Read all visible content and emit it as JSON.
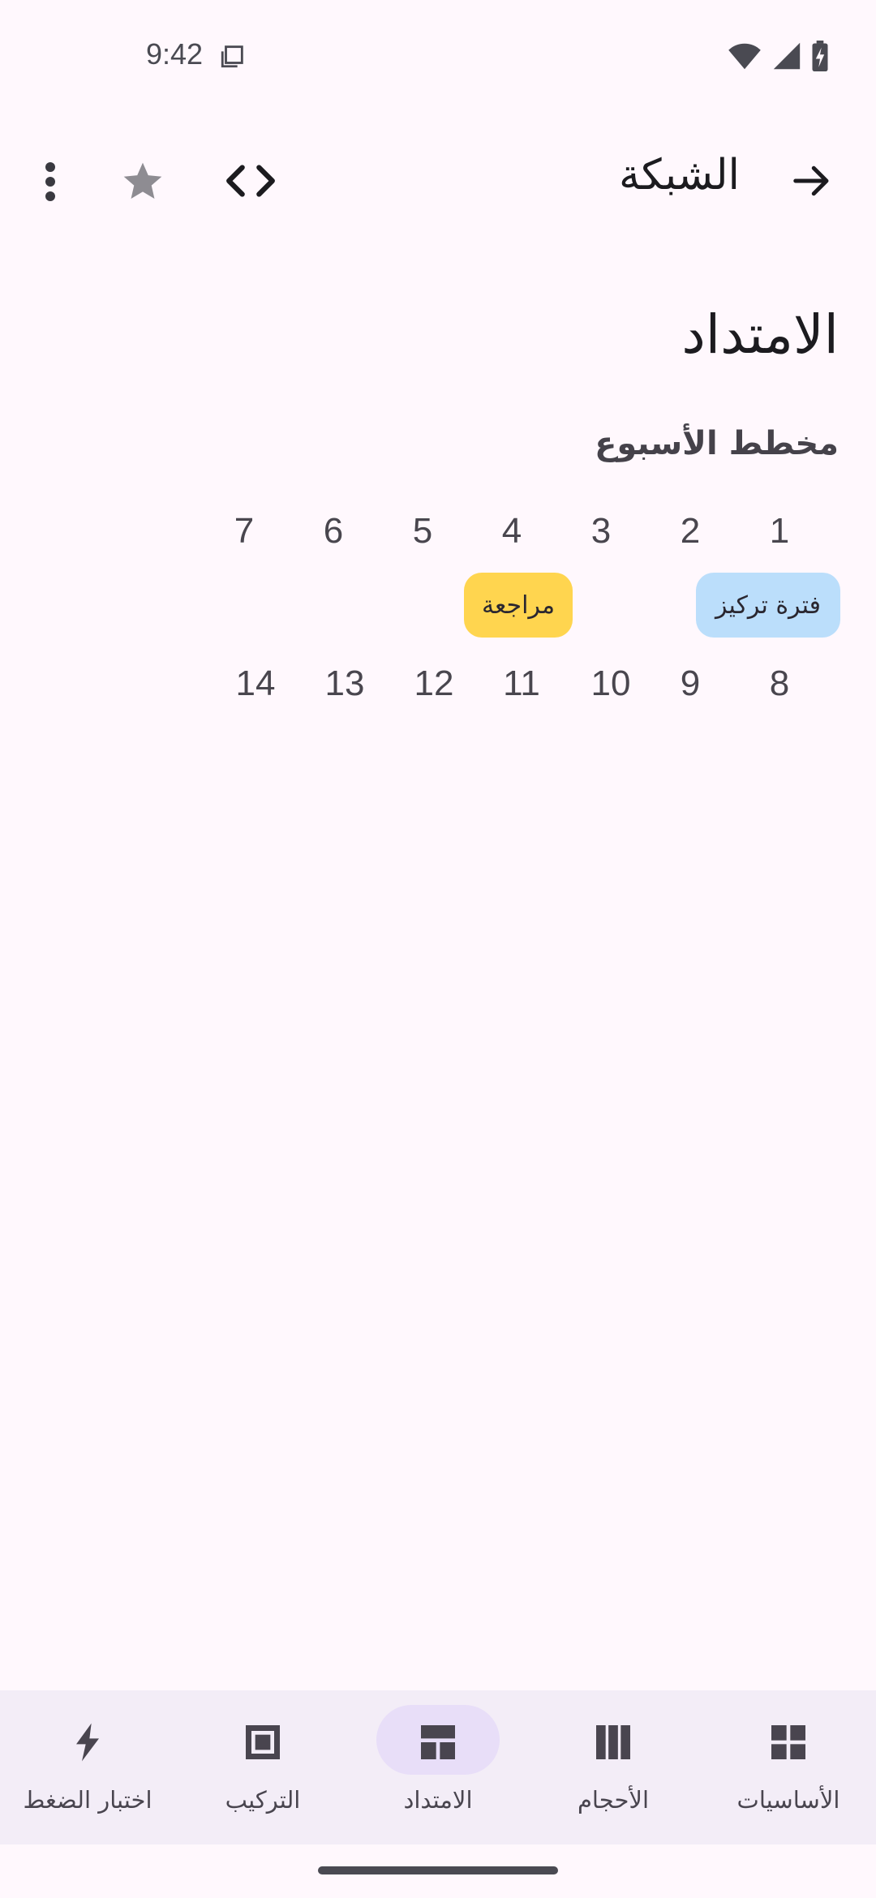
{
  "status_bar": {
    "time": "9:42"
  },
  "app_bar": {
    "title": "الشبكة"
  },
  "content": {
    "section_title": "الامتداد",
    "week_heading": "مخطط الأسبوع",
    "week1": [
      "1",
      "2",
      "3",
      "4",
      "5",
      "6",
      "7"
    ],
    "week2": [
      "8",
      "9",
      "10",
      "11",
      "12",
      "13",
      "14"
    ],
    "chips": {
      "focus": "فترة تركيز",
      "review": "مراجعة"
    }
  },
  "bottom_nav": {
    "items": [
      {
        "label": "الأساسيات",
        "icon": "grid-icon"
      },
      {
        "label": "الأحجام",
        "icon": "columns-icon"
      },
      {
        "label": "الامتداد",
        "icon": "span-layout-icon",
        "active": true
      },
      {
        "label": "التركيب",
        "icon": "composition-icon"
      },
      {
        "label": "اختبار الضغط",
        "icon": "bolt-icon"
      }
    ]
  },
  "colors": {
    "background": "#FFF8FD",
    "chip_review": "#FFD54F",
    "chip_focus": "#BBDEFB",
    "nav_active": "#E8DEF8"
  }
}
